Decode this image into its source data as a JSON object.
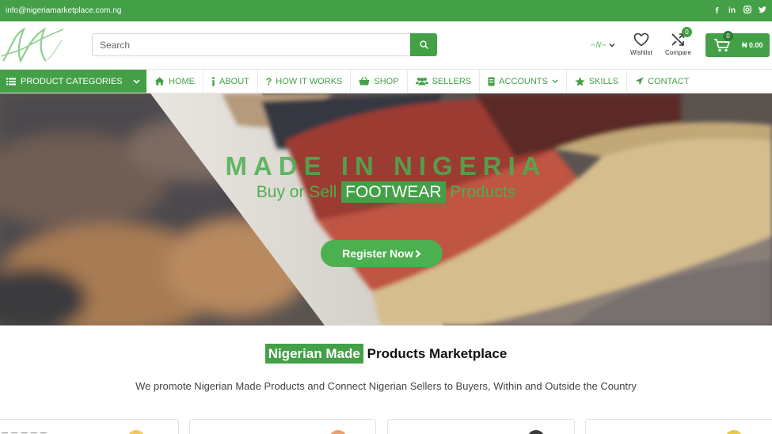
{
  "topbar": {
    "email": "info@nigeriamarketplace.com.ng",
    "socials": [
      "facebook-icon",
      "linkedin-icon",
      "instagram-icon",
      "twitter-icon"
    ]
  },
  "header": {
    "search_placeholder": "Search",
    "wishlist_label": "Wishlist",
    "compare_label": "Compare",
    "compare_count": "0",
    "cart_count": "0",
    "cart_amount": "₦ 0.00"
  },
  "nav": {
    "categories_label": "PRODUCT CATEGORIES",
    "items": [
      {
        "label": "HOME",
        "icon": "home-icon"
      },
      {
        "label": "ABOUT",
        "icon": "info-icon"
      },
      {
        "label": "HOW IT WORKS",
        "icon": "question-icon"
      },
      {
        "label": "SHOP",
        "icon": "basket-icon"
      },
      {
        "label": "SELLERS",
        "icon": "users-icon"
      },
      {
        "label": "ACCOUNTS",
        "icon": "id-card-icon"
      },
      {
        "label": "SKILLS",
        "icon": "star-icon"
      },
      {
        "label": "CONTACT",
        "icon": "send-icon"
      }
    ]
  },
  "hero": {
    "title": "MADE IN NIGERIA",
    "sub_before": "Buy or Sell",
    "sub_highlight": "FOOTWEAR",
    "sub_after": "Products",
    "button_label": "Register Now"
  },
  "section": {
    "title_highlight": "Nigerian Made",
    "title_rest": "Products Marketplace",
    "subtitle": "We promote Nigerian Made Products and Connect Nigerian Sellers to Buyers, Within and Outside the Country"
  },
  "colors": {
    "brand_green": "#43a047",
    "accent_green": "#4caf50"
  }
}
